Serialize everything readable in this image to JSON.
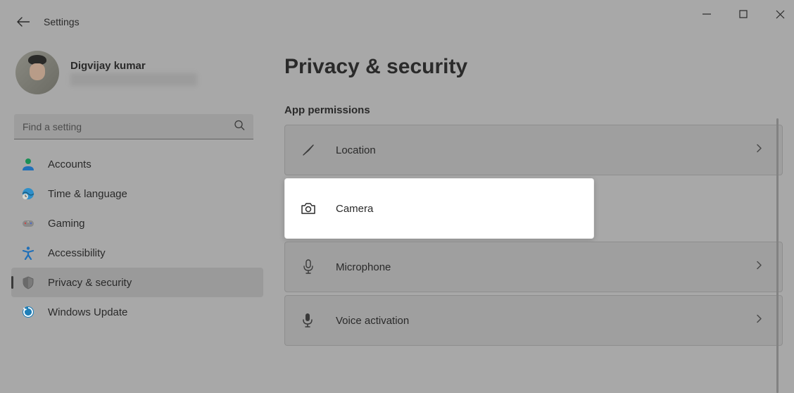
{
  "header": {
    "title": "Settings"
  },
  "profile": {
    "name": "Digvijay kumar"
  },
  "search": {
    "placeholder": "Find a setting"
  },
  "sidebar": {
    "items": [
      {
        "label": "Accounts",
        "icon": "accounts"
      },
      {
        "label": "Time & language",
        "icon": "time"
      },
      {
        "label": "Gaming",
        "icon": "gaming"
      },
      {
        "label": "Accessibility",
        "icon": "accessibility"
      },
      {
        "label": "Privacy & security",
        "icon": "privacy",
        "active": true
      },
      {
        "label": "Windows Update",
        "icon": "update"
      }
    ]
  },
  "page": {
    "title": "Privacy & security",
    "section": "App permissions"
  },
  "permissions": [
    {
      "label": "Location",
      "icon": "location"
    },
    {
      "label": "Camera",
      "icon": "camera",
      "highlighted": true
    },
    {
      "label": "Microphone",
      "icon": "microphone"
    },
    {
      "label": "Voice activation",
      "icon": "voice"
    }
  ]
}
